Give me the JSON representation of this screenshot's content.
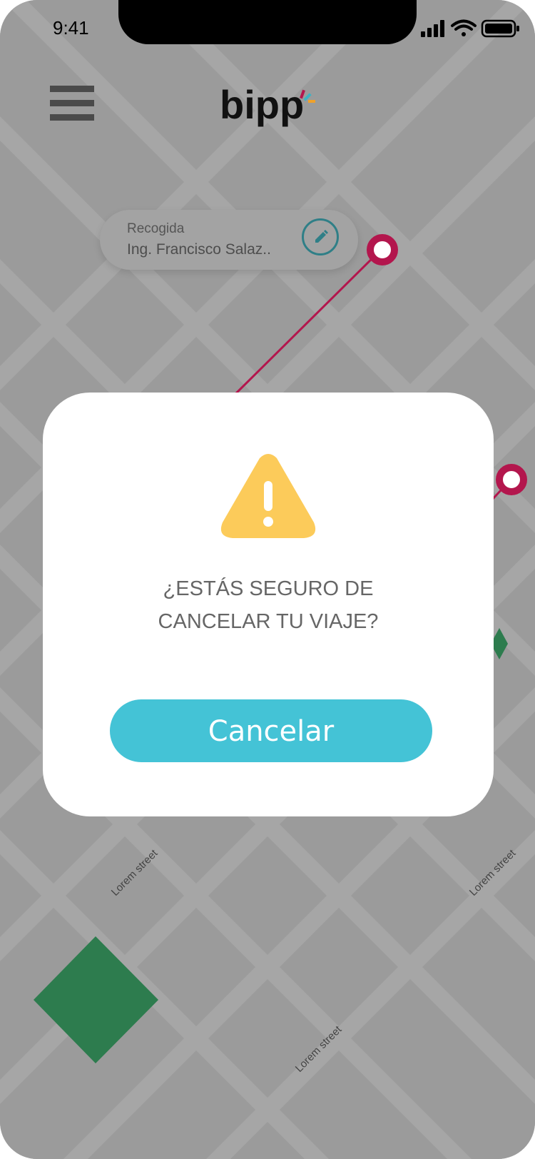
{
  "status_bar": {
    "time": "9:41"
  },
  "header": {
    "logo_text": "bipp"
  },
  "pickup": {
    "label": "Recogida",
    "value": "Ing. Francisco Salaz.."
  },
  "map": {
    "street_labels": [
      "Lorem street",
      "Lorem street",
      "Lorem street"
    ]
  },
  "modal": {
    "message_line1": "¿ESTÁS SEGURO DE",
    "message_line2": "CANCELAR TU VIAJE?",
    "button_label": "Cancelar"
  },
  "colors": {
    "accent": "#44C3D6",
    "route": "#B3164D",
    "warning": "#FCCB5A",
    "park": "#2D7C4E"
  },
  "icons": [
    "menu-icon",
    "pencil-icon",
    "warning-icon",
    "signal-icon",
    "wifi-icon",
    "battery-icon"
  ]
}
